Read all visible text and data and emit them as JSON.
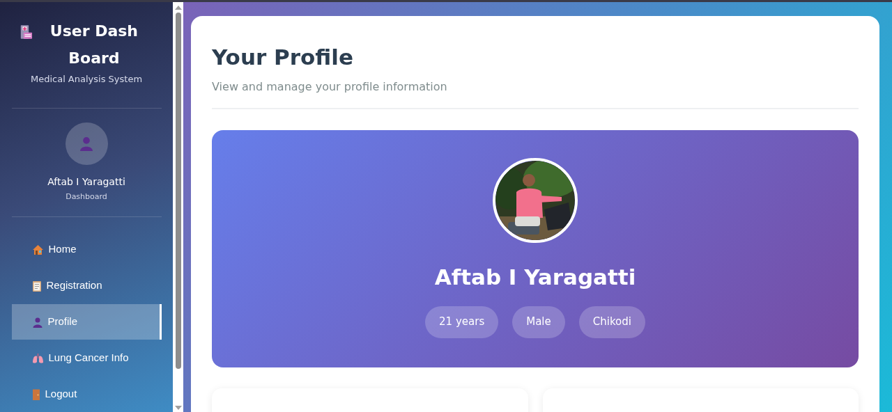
{
  "sidebar": {
    "title": "User Dash Board",
    "subtitle": "Medical Analysis System",
    "user": {
      "name": "Aftab I Yaragatti",
      "role": "Dashboard"
    },
    "items": [
      {
        "label": "Home",
        "selected": false
      },
      {
        "label": "Registration",
        "selected": false
      },
      {
        "label": "Profile",
        "selected": true
      },
      {
        "label": "Lung Cancer Info",
        "selected": false
      },
      {
        "label": "Logout",
        "selected": false
      }
    ]
  },
  "page": {
    "title": "Your Profile",
    "subtitle": "View and manage your profile information"
  },
  "profile": {
    "name": "Aftab I Yaragatti",
    "tags": [
      "21 years",
      "Male",
      "Chikodi"
    ]
  }
}
